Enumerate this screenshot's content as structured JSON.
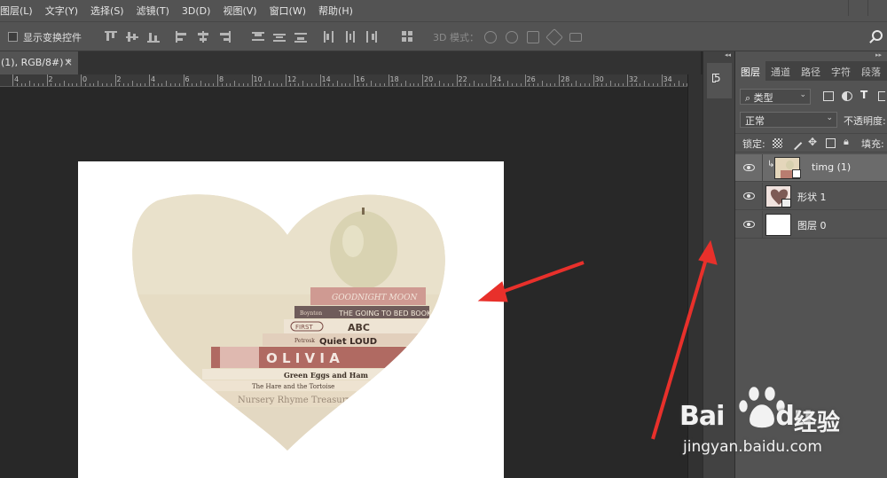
{
  "menu": [
    "图层(L)",
    "文字(Y)",
    "选择(S)",
    "滤镜(T)",
    "3D(D)",
    "视图(V)",
    "窗口(W)",
    "帮助(H)"
  ],
  "options": {
    "show_transform_controls": "显示变换控件",
    "mode_3d": "3D 模式："
  },
  "document_tab": {
    "title": "(1), RGB/8#) *",
    "close_glyph": "×"
  },
  "ruler_labels": [
    "4",
    "2",
    "0",
    "2",
    "4",
    "6",
    "8",
    "10",
    "12",
    "14",
    "16",
    "18",
    "20",
    "22",
    "24",
    "26",
    "28",
    "30",
    "32",
    "34"
  ],
  "artwork_texts": {
    "book1": "GOODNIGHT MOON",
    "book2": "THE GOING TO BED BOOK",
    "book2_small": "Boynton",
    "book3": "ABC",
    "book3_small": "FIRST",
    "book4": "Quiet LOUD",
    "book4_small": "Petrosk",
    "book5": "O L I V I A",
    "book6": "Green Eggs and Ham",
    "book7": "The Hare and the Tortoise",
    "book8": "Nursery Rhyme Treasury"
  },
  "layers_panel": {
    "tabs": [
      "图层",
      "通道",
      "路径",
      "字符",
      "段落"
    ],
    "active_tab": "图层",
    "filter_kind": "类型",
    "blend_mode": "正常",
    "opacity_label": "不透明度:",
    "lock_label": "锁定:",
    "fill_label": "填充:",
    "layers": [
      {
        "name": "timg (1)",
        "selected": true,
        "clipped": true
      },
      {
        "name": "形状 1",
        "selected": false,
        "clipped": false
      },
      {
        "name": "图层 0",
        "selected": false,
        "clipped": false
      }
    ]
  },
  "colors": {
    "annotation_arrow": "#e8302b",
    "heart_fill": "#e6dcc4",
    "selected_layer": "#6b6b6b"
  },
  "watermark": {
    "brand": "Bai",
    "brand_suffix": "du",
    "cn": "经验",
    "url": "jingyan.baidu.com"
  }
}
